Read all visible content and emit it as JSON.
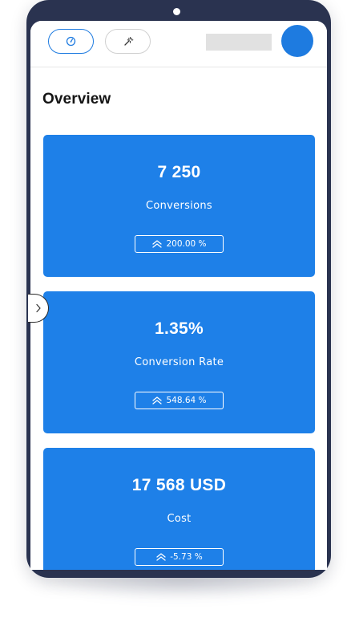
{
  "header": {
    "tabs": [
      {
        "icon": "gauge-icon",
        "active": true
      },
      {
        "icon": "magic-wand-icon",
        "active": false
      }
    ],
    "avatar_color": "#1e7be0"
  },
  "main": {
    "heading": "Overview",
    "cards": [
      {
        "value": "7 250",
        "label": "Conversions",
        "change": "200.00 %",
        "trend_icon": "chevrons-up-icon"
      },
      {
        "value": "1.35%",
        "label": "Conversion Rate",
        "change": "548.64 %",
        "trend_icon": "chevrons-up-icon"
      },
      {
        "value": "17 568 USD",
        "label": "Cost",
        "change": "-5.73 %",
        "trend_icon": "chevrons-up-icon"
      }
    ]
  },
  "sidebar_toggle": {
    "icon": "chevron-right-icon"
  },
  "colors": {
    "accent": "#1e7be0",
    "card_background": "#1e80e8",
    "device_frame": "#2a3350",
    "placeholder": "#e1e1e1"
  }
}
